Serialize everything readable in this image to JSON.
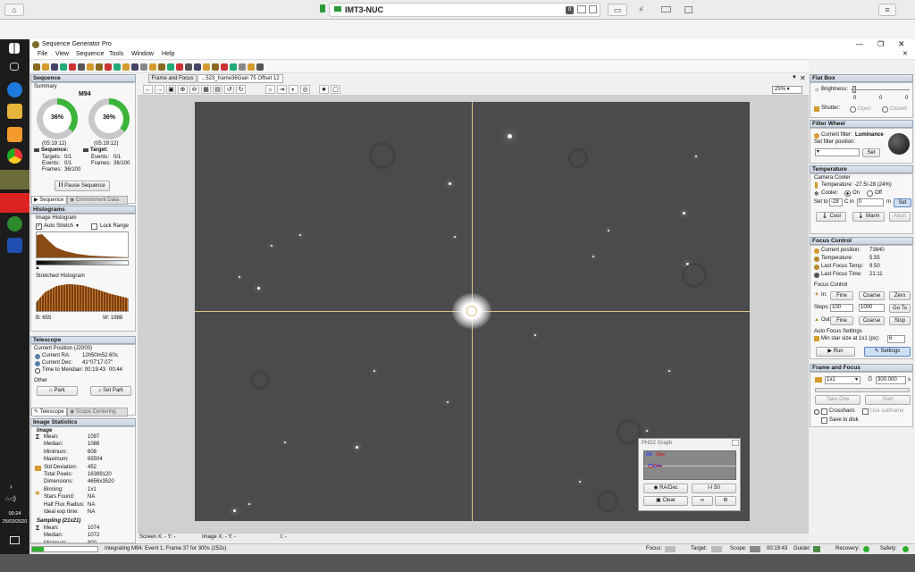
{
  "remote": {
    "host": "IMT3-NUC",
    "counter": "0"
  },
  "taskbar": {
    "time": "00:24",
    "date": "25/03/2020"
  },
  "app": {
    "title": "Sequence Generator Pro",
    "menu": [
      "File",
      "View",
      "Sequence",
      "Tools",
      "Window",
      "Help"
    ]
  },
  "sequence": {
    "header": "Sequence",
    "summary": "Summary",
    "target_name": "M94",
    "seq_percent": "36%",
    "target_percent": "36%",
    "seq_time": "(05:19:12)",
    "target_time": "(05:19:12)",
    "seq_label": "Sequence:",
    "target_label": "Target:",
    "seq_rows": [
      "Targets:",
      "0/1",
      "Events:",
      "0/1",
      "Frames:",
      "36/100"
    ],
    "target_rows": [
      "Events:",
      "0/1",
      "Frames:",
      "36/100"
    ],
    "pause_button": "Pause Sequence",
    "tab_sequence": "Sequence",
    "tab_environment": "Environment Data"
  },
  "histograms": {
    "header": "Histograms",
    "image_histogram": "Image Histogram",
    "auto_stretch": "Auto Stretch",
    "lock_range": "Lock Range",
    "stretched_histogram": "Stretched Histogram",
    "b_value": "B: 655",
    "w_value": "W:  1988"
  },
  "telescope": {
    "header": "Telescope",
    "current_position": "Current Position (J2000)",
    "ra_label": "Current RA:",
    "ra_value": "12h50m52.60s",
    "dec_label": "Current Dec:",
    "dec_value": "41°07'17.07\"",
    "meridian_label": "Time to Meridian: 00:19:43",
    "meridian_value": "00:44",
    "other": "Other",
    "park_button": "Park",
    "set_park_button": "Set Park",
    "tab_telescope": "Telescope",
    "tab_centering": "Scope Centering"
  },
  "image_stats": {
    "header": "Image Statistics",
    "image_title": "Image",
    "rows": [
      [
        "Mean:",
        "1097"
      ],
      [
        "Median:",
        "1088"
      ],
      [
        "Minimum:",
        "608"
      ],
      [
        "Maximum:",
        "65504"
      ],
      [
        "Std Deviation:",
        "452"
      ],
      [
        "Total Pixels:",
        "16389120"
      ],
      [
        "Dimensions:",
        "4656x3520"
      ],
      [
        "Binning:",
        "1x1"
      ],
      [
        "Stars Found:",
        "NA"
      ],
      [
        "Half Flux Radius:",
        "NA"
      ],
      [
        "Ideal exp time:",
        "NA"
      ]
    ],
    "sampling_title": "Sampling (21x21)",
    "sampling_rows": [
      [
        "Mean:",
        "1074"
      ],
      [
        "Median:",
        "1072"
      ],
      [
        "Minimum:",
        "800"
      ]
    ]
  },
  "viewer": {
    "tab_frame": "Frame and Focus",
    "tab_image": "...523_frame36Gain 75 Offset 12",
    "zoom": "25%",
    "screen_coords": "Screen X: - Y: -",
    "image_coords": "Image X: - Y: -",
    "intensity": "I: -"
  },
  "phd2": {
    "title": "PHD2 Graph",
    "ra_legend": "RA",
    "dec_legend": "Dec",
    "radec_button": "RA/Dec",
    "scale_button": "I-I 50",
    "clear_button": "Clear"
  },
  "flatbox": {
    "header": "Flat Box",
    "brightness": "Brightness:",
    "b_values": [
      "0",
      "0",
      "0"
    ],
    "shutter": "Shutter:",
    "open": "Open",
    "closed": "Closed"
  },
  "filterwheel": {
    "header": "Filter Wheel",
    "current_label": "Current filter:",
    "current_value": "Luminance",
    "set_label": "Set filter position:",
    "set_button": "Set"
  },
  "temperature": {
    "header": "Temperature",
    "camera_cooler": "Camera Cooler",
    "temp_label": "Temperature: -27.5/-28 (24%)",
    "cooler": "Cooler:",
    "on": "On",
    "off": "Off",
    "set_to": "Set to",
    "set_value": "-28",
    "c_in": "C in",
    "minutes_value": "0",
    "m": "m",
    "set_button": "Set",
    "cool_button": "Cool",
    "warm_button": "Warm",
    "abort_button": "Abort"
  },
  "focus": {
    "header": "Focus Control",
    "rows": [
      [
        "Current position:",
        "73840"
      ],
      [
        "Temperature:",
        "5.55"
      ],
      [
        "Last Focus Temp:",
        "9.50"
      ],
      [
        "Last Focus Time:",
        "21:11"
      ]
    ],
    "focus_control": "Focus Control",
    "in_label": "In:",
    "out_label": "Out:",
    "steps_label": "Steps:",
    "steps_a": "100",
    "steps_b": "1000",
    "fine": "Fine",
    "coarse": "Coarse",
    "zero": "Zero",
    "goto": "Go To",
    "stop": "Stop",
    "auto_focus": "Auto Focus Settings",
    "min_star": "Min star size at 1x1 (px):",
    "min_star_value": "6",
    "run": "Run",
    "settings": "Settings"
  },
  "frame_focus": {
    "header": "Frame and Focus",
    "binning": "1x1",
    "exposure": "300.000",
    "unit": "s",
    "take_one": "Take One",
    "start": "Start",
    "crosshairs": "Crosshairs",
    "use_subframe": "Use subframe",
    "save_disk": "Save to disk"
  },
  "status": {
    "message": "Integrating M94; Event 1; Frame 37 for 300s (252s)",
    "focus": "Focus:",
    "target": "Target:",
    "scope": "Scope:",
    "scope_time": "00:19:43",
    "guider": "Guider:",
    "recovery": "Recovery:",
    "safety": "Safety:"
  }
}
